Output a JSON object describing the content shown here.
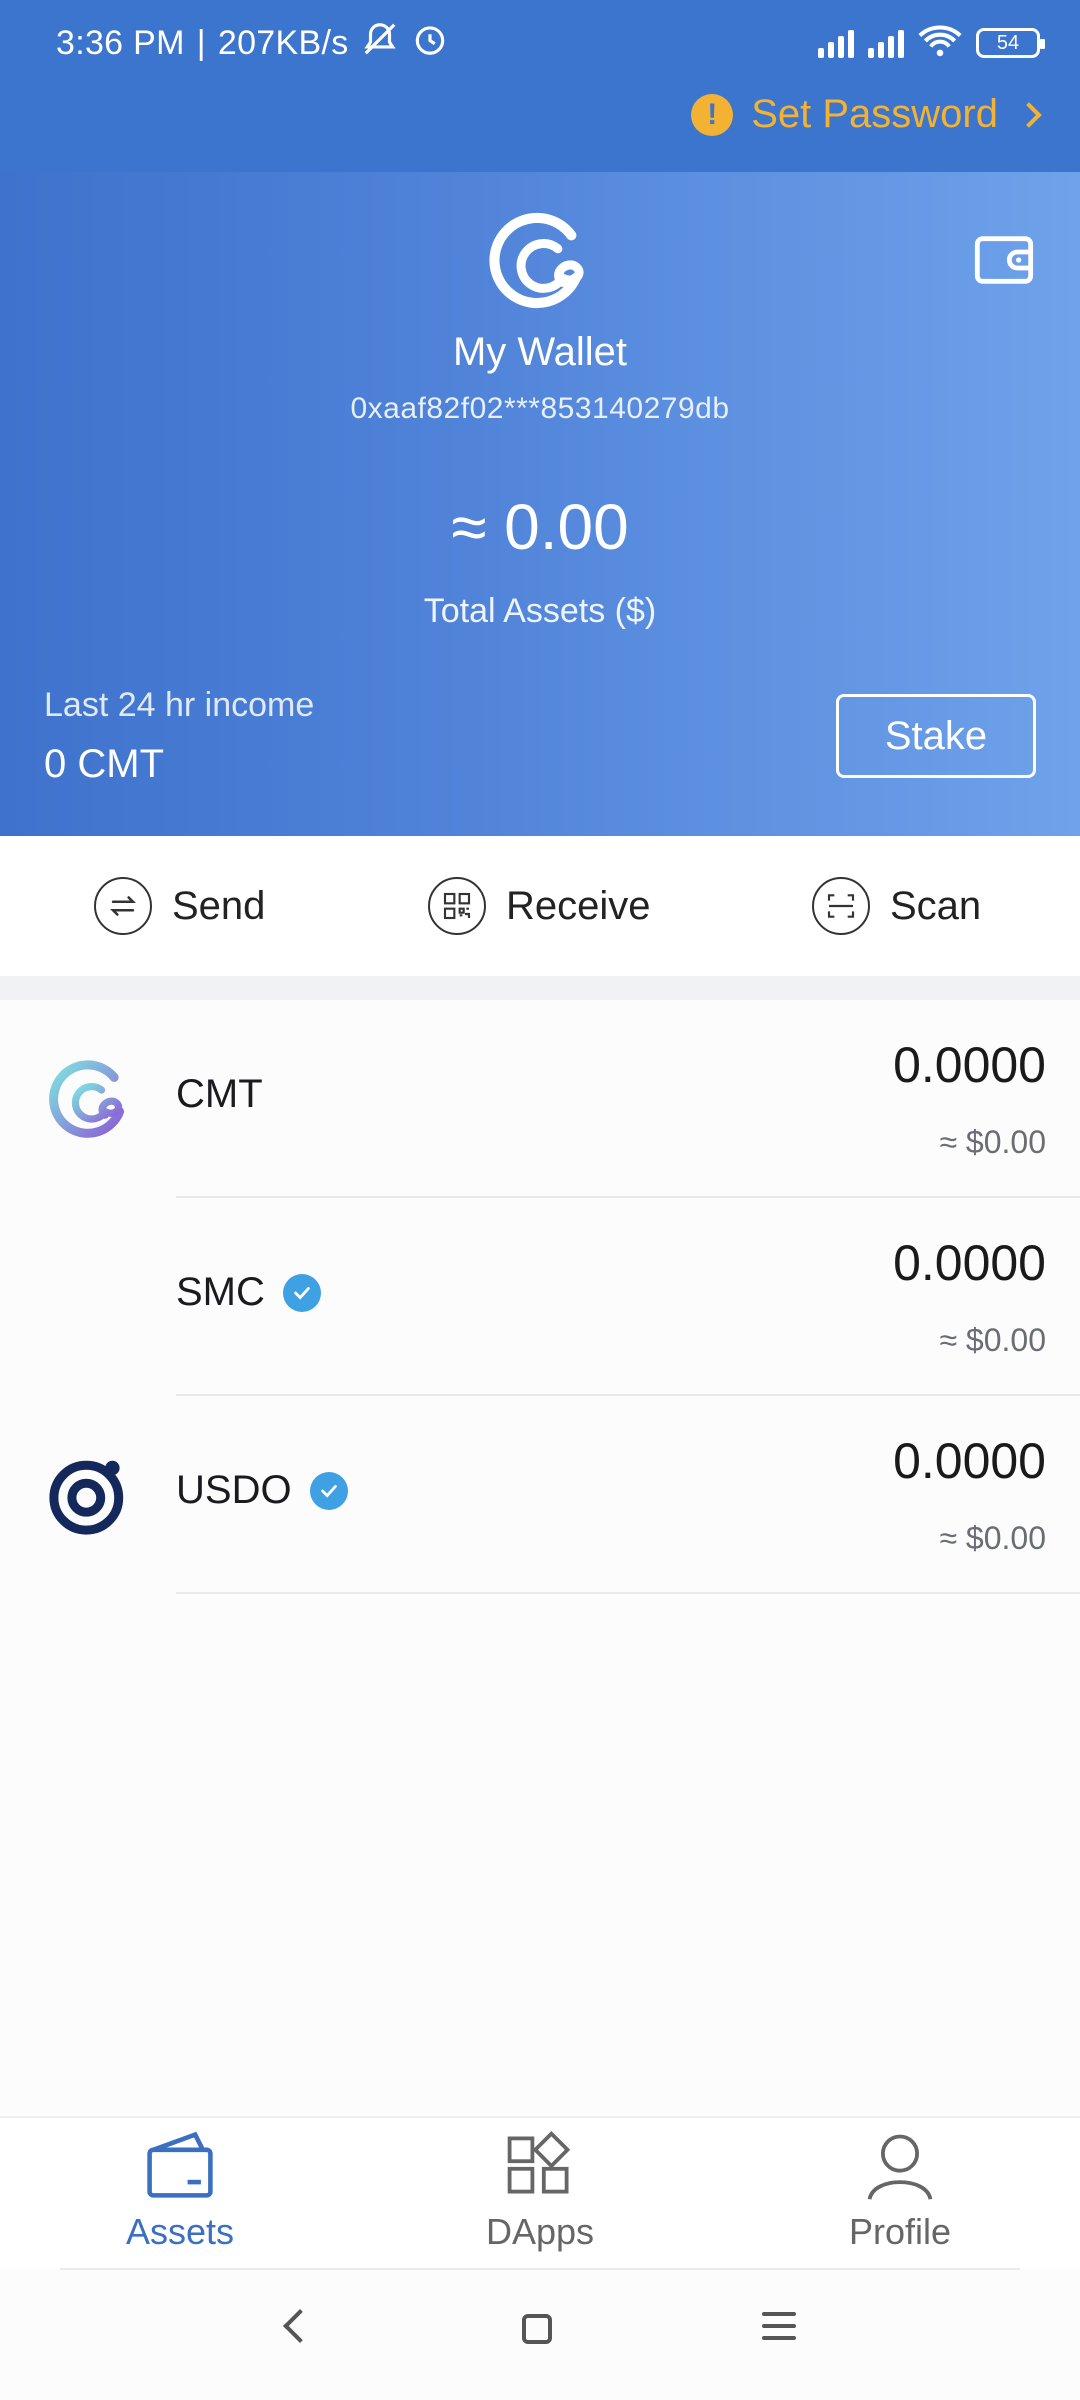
{
  "status_bar": {
    "time": "3:36 PM",
    "network_speed": "207KB/s",
    "battery": "54"
  },
  "top": {
    "set_password_label": "Set Password"
  },
  "wallet": {
    "name": "My Wallet",
    "address": "0xaaf82f02***853140279db",
    "total": "≈ 0.00",
    "total_label": "Total Assets ($)",
    "income_label": "Last 24 hr income",
    "income_value": "0 CMT",
    "stake_label": "Stake"
  },
  "actions": [
    {
      "label": "Send"
    },
    {
      "label": "Receive"
    },
    {
      "label": "Scan"
    }
  ],
  "tokens": [
    {
      "symbol": "CMT",
      "amount": "0.0000",
      "fiat": "≈  $0.00",
      "verified": false
    },
    {
      "symbol": "SMC",
      "amount": "0.0000",
      "fiat": "≈  $0.00",
      "verified": true
    },
    {
      "symbol": "USDO",
      "amount": "0.0000",
      "fiat": "≈  $0.00",
      "verified": true
    }
  ],
  "bottom_nav": [
    {
      "label": "Assets",
      "active": true
    },
    {
      "label": "DApps",
      "active": false
    },
    {
      "label": "Profile",
      "active": false
    }
  ],
  "colors": {
    "accent": "#3c75cd",
    "warning": "#f3b233",
    "verified": "#3fa0e4",
    "active_nav": "#3b6fc2"
  }
}
